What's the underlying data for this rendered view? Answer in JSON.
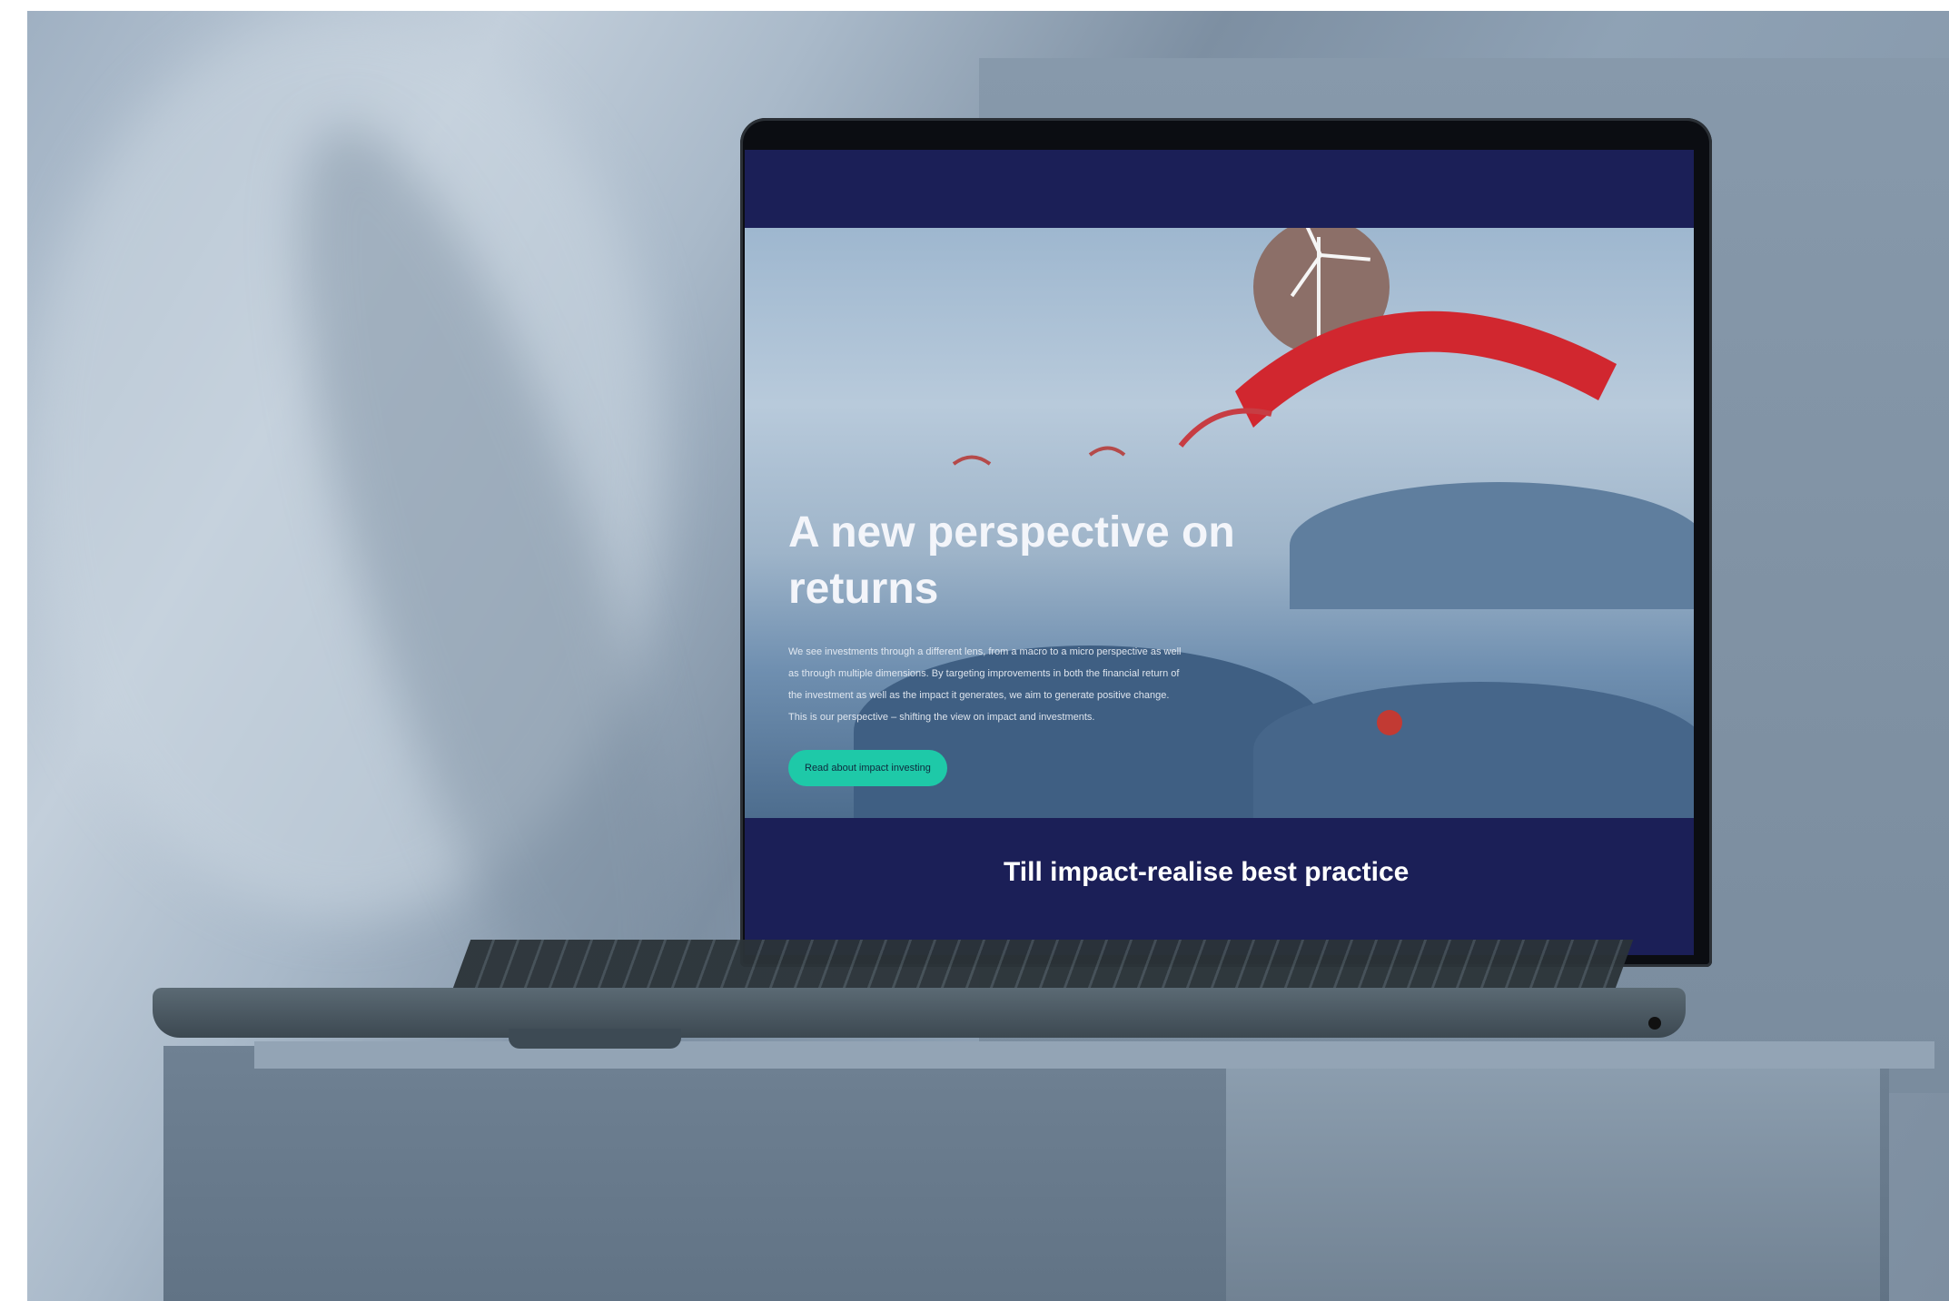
{
  "hero": {
    "title": "A new perspective on returns",
    "body": "We see investments through a different lens, from a macro to a micro perspective as well as through multiple dimensions. By targeting improvements in both the financial return of the investment as well as the impact it generates, we aim to generate positive change. This is our perspective – shifting the view on impact and investments.",
    "cta_label": "Read about impact investing"
  },
  "lower": {
    "title": "Till impact-realise best practice"
  }
}
